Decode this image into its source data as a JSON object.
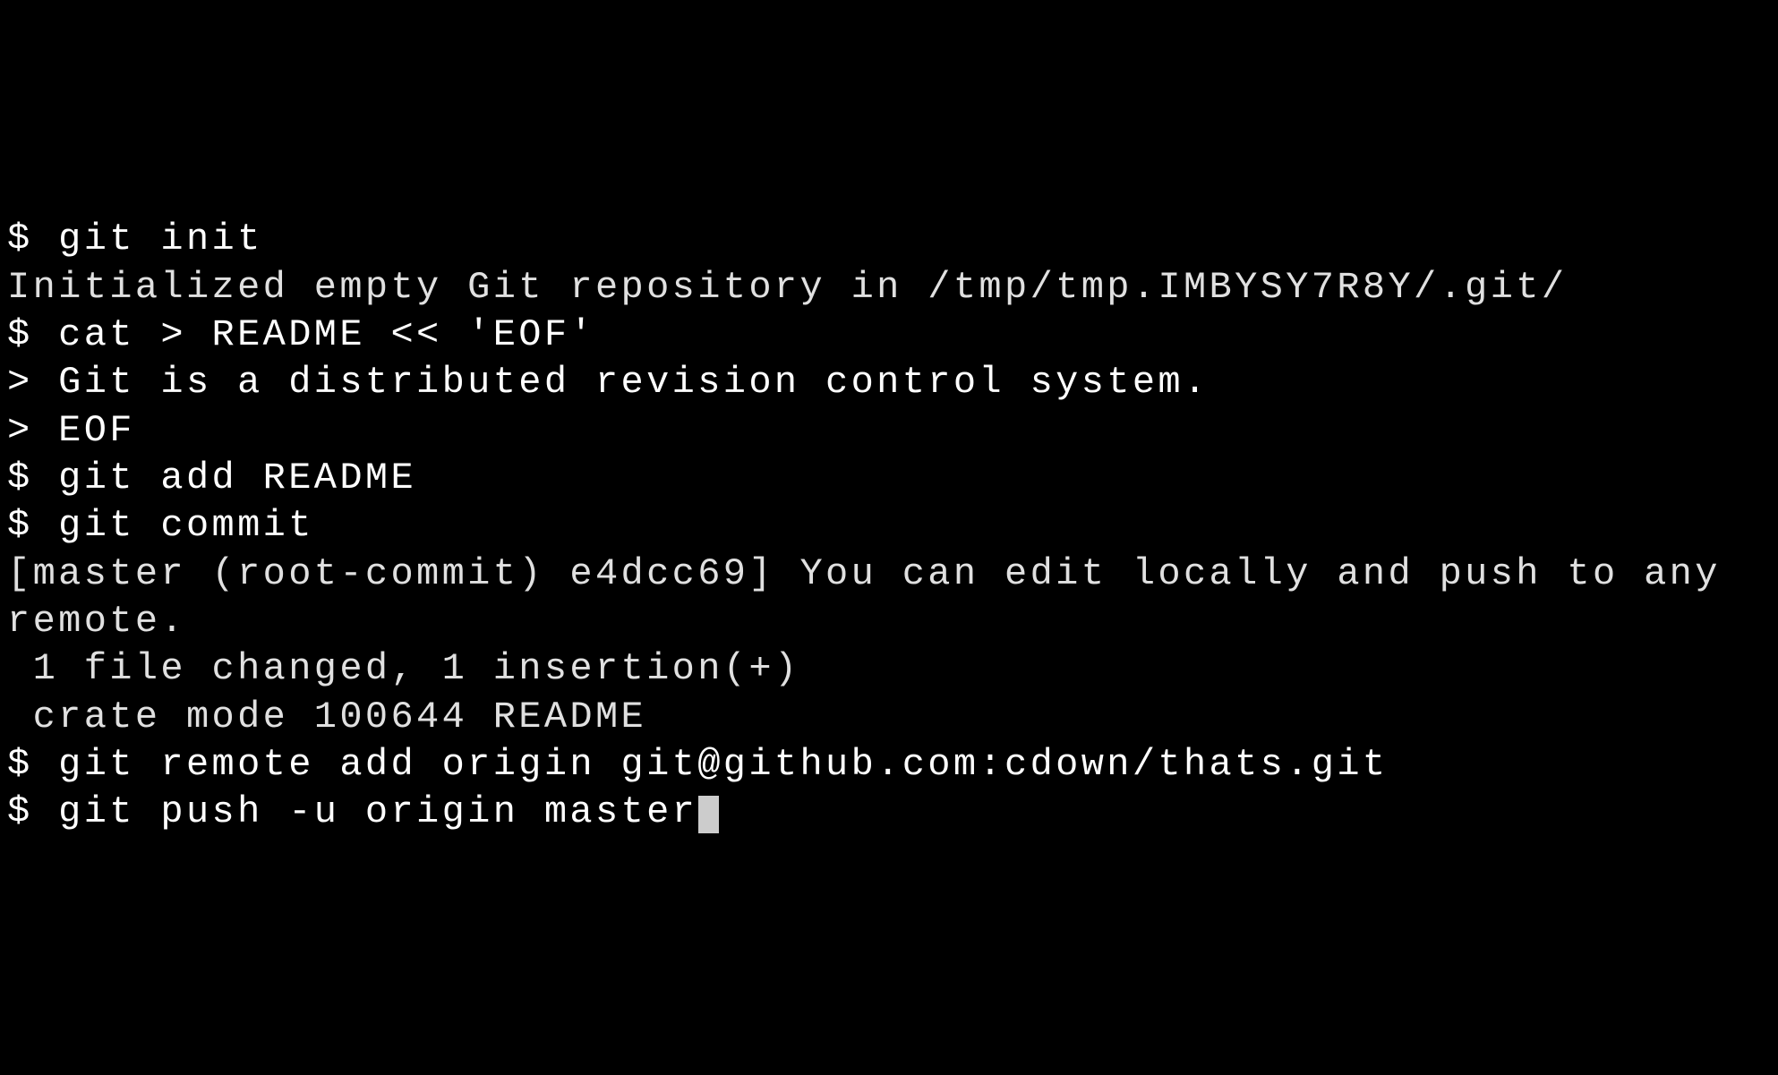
{
  "terminal": {
    "prompt": "$",
    "heredoc_prompt": ">",
    "lines": {
      "l1": "$ git init",
      "l2": "Initialized empty Git repository in /tmp/tmp.IMBYSY7R8Y/.git/",
      "l3": "$ cat > README << 'EOF'",
      "l4": "> Git is a distributed revision control system.",
      "l5": "> EOF",
      "l6": "$ git add README",
      "l7": "$ git commit",
      "l8": "[master (root-commit) e4dcc69] You can edit locally and push to any remote.",
      "l9": " 1 file changed, 1 insertion(+)",
      "l10": " crate mode 100644 README",
      "l11": "$ git remote add origin git@github.com:cdown/thats.git",
      "l12": "$ git push -u origin master"
    }
  }
}
